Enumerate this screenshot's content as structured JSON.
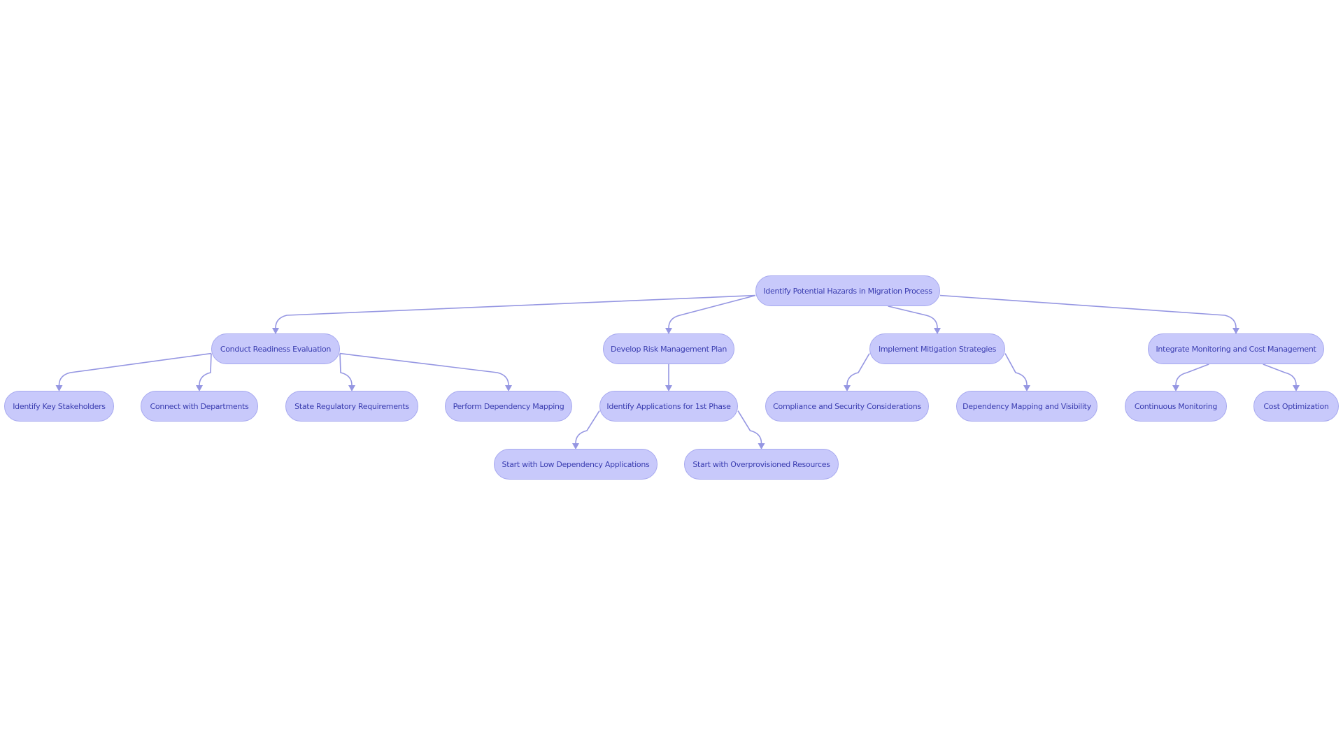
{
  "diagram": {
    "type": "flowchart-tree",
    "colors": {
      "node_fill": "#c8c9fb",
      "node_border": "#a7a9ef",
      "node_text": "#3a3db0",
      "edge": "#9596e2",
      "background": "#ffffff"
    },
    "nodes": [
      {
        "id": "root",
        "label": "Identify Potential Hazards in Migration Process"
      },
      {
        "id": "readiness",
        "label": "Conduct Readiness Evaluation"
      },
      {
        "id": "riskplan",
        "label": "Develop Risk Management Plan"
      },
      {
        "id": "mitigation",
        "label": "Implement Mitigation Strategies"
      },
      {
        "id": "monitoring",
        "label": "Integrate Monitoring and Cost Management"
      },
      {
        "id": "stakeholders",
        "label": "Identify Key Stakeholders"
      },
      {
        "id": "departments",
        "label": "Connect with Departments"
      },
      {
        "id": "regulatory",
        "label": "State Regulatory Requirements"
      },
      {
        "id": "depmapping",
        "label": "Perform Dependency Mapping"
      },
      {
        "id": "apps1st",
        "label": "Identify Applications for 1st Phase"
      },
      {
        "id": "compliance",
        "label": "Compliance and Security Considerations"
      },
      {
        "id": "visibility",
        "label": "Dependency Mapping and Visibility"
      },
      {
        "id": "contmon",
        "label": "Continuous Monitoring"
      },
      {
        "id": "costopt",
        "label": "Cost Optimization"
      },
      {
        "id": "lowdep",
        "label": "Start with Low Dependency Applications"
      },
      {
        "id": "overprov",
        "label": "Start with Overprovisioned Resources"
      }
    ],
    "edges": [
      {
        "from": "root",
        "to": "readiness"
      },
      {
        "from": "root",
        "to": "riskplan"
      },
      {
        "from": "root",
        "to": "mitigation"
      },
      {
        "from": "root",
        "to": "monitoring"
      },
      {
        "from": "readiness",
        "to": "stakeholders"
      },
      {
        "from": "readiness",
        "to": "departments"
      },
      {
        "from": "readiness",
        "to": "regulatory"
      },
      {
        "from": "readiness",
        "to": "depmapping"
      },
      {
        "from": "riskplan",
        "to": "apps1st"
      },
      {
        "from": "apps1st",
        "to": "lowdep"
      },
      {
        "from": "apps1st",
        "to": "overprov"
      },
      {
        "from": "mitigation",
        "to": "compliance"
      },
      {
        "from": "mitigation",
        "to": "visibility"
      },
      {
        "from": "monitoring",
        "to": "contmon"
      },
      {
        "from": "monitoring",
        "to": "costopt"
      }
    ]
  }
}
